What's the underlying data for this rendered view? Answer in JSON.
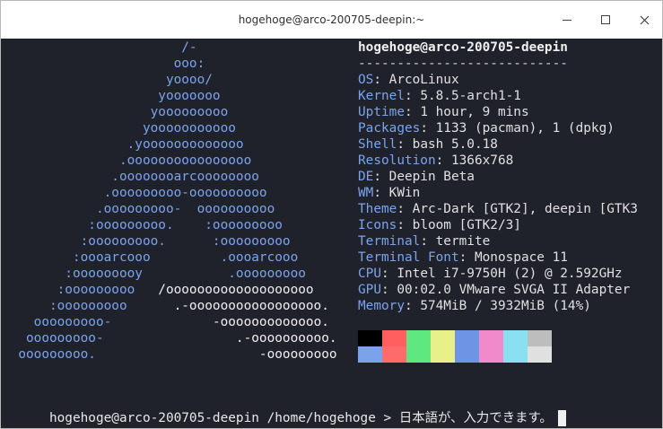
{
  "window": {
    "title": "hogehoge@arco-200705-deepin:~"
  },
  "neofetch": {
    "logo": [
      [
        {
          "t": "                       /-",
          "c": "blue"
        }
      ],
      [
        {
          "t": "                      ooo:",
          "c": "blue"
        }
      ],
      [
        {
          "t": "                     yoooo/",
          "c": "blue"
        }
      ],
      [
        {
          "t": "                    yooooooo",
          "c": "blue"
        }
      ],
      [
        {
          "t": "                   yooooooooo",
          "c": "blue"
        }
      ],
      [
        {
          "t": "                  yooooooooooo",
          "c": "blue"
        }
      ],
      [
        {
          "t": "                .yooooooooooooo",
          "c": "blue"
        }
      ],
      [
        {
          "t": "               .oooooooooooooooo",
          "c": "blue"
        }
      ],
      [
        {
          "t": "              .oooooooarcoooooooo",
          "c": "blue"
        }
      ],
      [
        {
          "t": "             .ooooooooo-oooooooooo",
          "c": "blue"
        }
      ],
      [
        {
          "t": "            .ooooooooo-  oooooooooo",
          "c": "blue"
        }
      ],
      [
        {
          "t": "           :ooooooooo.    :ooooooooo",
          "c": "blue"
        }
      ],
      [
        {
          "t": "          :ooooooooo.      :ooooooooo",
          "c": "blue"
        }
      ],
      [
        {
          "t": "         :oooarcooo         .oooarcooo",
          "c": "blue"
        }
      ],
      [
        {
          "t": "        :ooooooooy           .ooooooooo",
          "c": "blue"
        }
      ],
      [
        {
          "t": "       :ooooooooo   ",
          "c": "blue"
        },
        {
          "t": "/ooooooooooooooooooo",
          "c": "white"
        }
      ],
      [
        {
          "t": "      :ooooooooo      ",
          "c": "blue"
        },
        {
          "t": ".-ooooooooooooooooo.",
          "c": "white"
        }
      ],
      [
        {
          "t": "    ooooooooo-             ",
          "c": "blue"
        },
        {
          "t": "-ooooooooooooo.",
          "c": "white"
        }
      ],
      [
        {
          "t": "   ooooooooo-                 ",
          "c": "blue"
        },
        {
          "t": ".-oooooooooo.",
          "c": "white"
        }
      ],
      [
        {
          "t": "  ooooooooo.                     ",
          "c": "blue"
        },
        {
          "t": "-ooooooooo",
          "c": "white"
        }
      ]
    ],
    "header": "hogehoge@arco-200705-deepin",
    "separator": "---------------------------",
    "info": [
      {
        "key": "OS",
        "value": "ArcoLinux"
      },
      {
        "key": "Kernel",
        "value": "5.8.5-arch1-1"
      },
      {
        "key": "Uptime",
        "value": "1 hour, 9 mins"
      },
      {
        "key": "Packages",
        "value": "1133 (pacman), 1 (dpkg)"
      },
      {
        "key": "Shell",
        "value": "bash 5.0.18"
      },
      {
        "key": "Resolution",
        "value": "1366x768"
      },
      {
        "key": "DE",
        "value": "Deepin Beta"
      },
      {
        "key": "WM",
        "value": "KWin"
      },
      {
        "key": "Theme",
        "value": "Arc-Dark [GTK2], deepin [GTK3"
      },
      {
        "key": "Icons",
        "value": "bloom [GTK2/3]"
      },
      {
        "key": "Terminal",
        "value": "termite"
      },
      {
        "key": "Terminal Font",
        "value": "Monospace 11"
      },
      {
        "key": "CPU",
        "value": "Intel i7-9750H (2) @ 2.592GHz"
      },
      {
        "key": "GPU",
        "value": "00:02.0 VMware SVGA II Adapter"
      },
      {
        "key": "Memory",
        "value": "574MiB / 3932MiB (14%)"
      }
    ],
    "palette_normal": [
      "#000000",
      "#ff5f5f",
      "#5fe87f",
      "#e8f08a",
      "#6e94e6",
      "#f08acb",
      "#8ae0f0",
      "#bdbdbd"
    ],
    "palette_bright": [
      "#7ba3ec",
      "#ff6b6b",
      "#5fe87f",
      "#e8f08a",
      "#6e94e6",
      "#f08acb",
      "#8ae0f0",
      "#e0e0e0"
    ]
  },
  "prompt": {
    "text": "hogehoge@arco-200705-deepin /home/hogehoge > 日本語が、入力できます。"
  },
  "colors": {
    "terminal_bg": "#20222b",
    "logo_blue": "#7ba3ec"
  }
}
